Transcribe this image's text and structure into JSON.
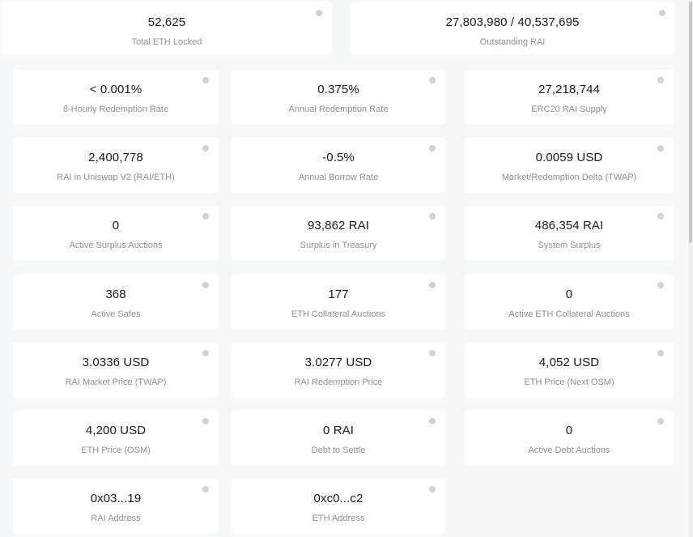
{
  "top_stats": [
    {
      "value": "52,625",
      "label": "Total ETH Locked"
    },
    {
      "value": "27,803,980 / 40,537,695",
      "label": "Outstanding RAI"
    }
  ],
  "stats": [
    {
      "value": "< 0.001%",
      "label": "8-Hourly Redemption Rate"
    },
    {
      "value": "0.375%",
      "label": "Annual Redemption Rate"
    },
    {
      "value": "27,218,744",
      "label": "ERC20 RAI Supply"
    },
    {
      "value": "2,400,778",
      "label": "RAI in Uniswap V2 (RAI/ETH)"
    },
    {
      "value": "-0.5%",
      "label": "Annual Borrow Rate"
    },
    {
      "value": "0.0059 USD",
      "label": "Market/Redemption Delta (TWAP)"
    },
    {
      "value": "0",
      "label": "Active Surplus Auctions"
    },
    {
      "value": "93,862 RAI",
      "label": "Surplus in Treasury"
    },
    {
      "value": "486,354 RAI",
      "label": "System Surplus"
    },
    {
      "value": "368",
      "label": "Active Safes"
    },
    {
      "value": "177",
      "label": "ETH Collateral Auctions"
    },
    {
      "value": "0",
      "label": "Active ETH Collateral Auctions"
    },
    {
      "value": "3.0336 USD",
      "label": "RAI Market Price (TWAP)"
    },
    {
      "value": "3.0277 USD",
      "label": "RAI Redemption Price"
    },
    {
      "value": "4,052 USD",
      "label": "ETH Price (Next OSM)"
    },
    {
      "value": "4,200 USD",
      "label": "ETH Price (OSM)"
    },
    {
      "value": "0 RAI",
      "label": "Debt to Settle"
    },
    {
      "value": "0",
      "label": "Active Debt Auctions"
    },
    {
      "value": "0x03...19",
      "label": "RAI Address"
    },
    {
      "value": "0xc0...c2",
      "label": "ETH Address"
    }
  ],
  "icon_names": {
    "info": "info-icon"
  },
  "colors": {
    "value_text": "#1a1a1a",
    "label_text": "#8a8f98",
    "card_bg": "#ffffff",
    "page_bg": "#f7f8fa",
    "info_icon": "#cfd3d8"
  }
}
